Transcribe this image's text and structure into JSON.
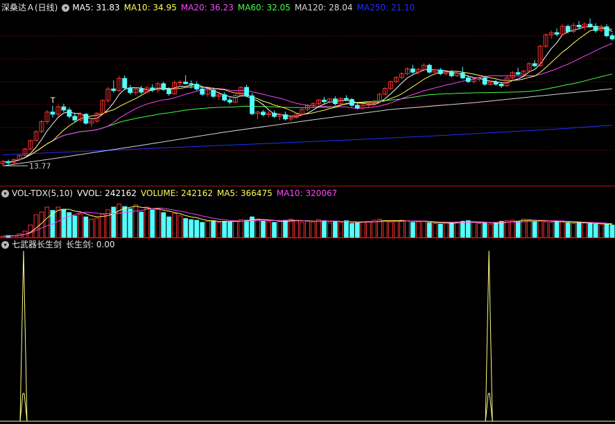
{
  "header1": {
    "title": "深桑达Ａ(日线)",
    "ma": [
      {
        "label": "MA5: 31.83",
        "color": "#ffffff"
      },
      {
        "label": "MA10: 34.95",
        "color": "#ffff55"
      },
      {
        "label": "MA20: 36.23",
        "color": "#ff44ff"
      },
      {
        "label": "MA60: 32.05",
        "color": "#44ff44"
      },
      {
        "label": "MA120: 28.04",
        "color": "#d8d8d8"
      },
      {
        "label": "MA250: 21.10",
        "color": "#2030ff"
      }
    ]
  },
  "header2": {
    "title": "VOL-TDX(5,10)",
    "vol": [
      {
        "label": "VVOL: 242162",
        "color": "#ffffff"
      },
      {
        "label": "VOLUME: 242162",
        "color": "#ffff55"
      },
      {
        "label": "MA5: 366475",
        "color": "#ffff55"
      },
      {
        "label": "MA10: 320067",
        "color": "#ff44ff"
      }
    ]
  },
  "header3": {
    "title": "七武器长生剑",
    "value": "长生剑: 0.00"
  },
  "annotations": {
    "low_price": "13.77",
    "marker": "T"
  },
  "colors": {
    "up": "#ff3232",
    "down": "#54ffff",
    "grid": "#b80f0f",
    "ma5": "#ffffff",
    "ma10": "#ffff55",
    "ma20": "#ff44ff",
    "ma60": "#44ff44",
    "ma120": "#d8d8d8",
    "ma250": "#2030ff",
    "signal": "#ffff88"
  },
  "chart_data": [
    {
      "type": "candlestick",
      "y_range": [
        12,
        42
      ],
      "bars_per_window": 111,
      "candles": [
        [
          13.8,
          14.5,
          13.4,
          14.2
        ],
        [
          14.2,
          14.6,
          13.6,
          14.0
        ],
        [
          14.0,
          14.8,
          13.7,
          14.6
        ],
        [
          14.6,
          15.5,
          14.3,
          15.4
        ],
        [
          15.4,
          16.8,
          15.2,
          16.6
        ],
        [
          16.6,
          18.4,
          16.4,
          18.2
        ],
        [
          18.2,
          20.2,
          18.0,
          19.9
        ],
        [
          19.9,
          22.1,
          19.6,
          21.8
        ],
        [
          21.8,
          24.0,
          21.3,
          23.6
        ],
        [
          23.6,
          24.8,
          22.6,
          23.2
        ],
        [
          23.2,
          25.0,
          22.8,
          24.6
        ],
        [
          24.6,
          25.2,
          23.6,
          24.0
        ],
        [
          24.0,
          24.5,
          22.4,
          22.8
        ],
        [
          22.8,
          23.5,
          21.6,
          22.1
        ],
        [
          22.1,
          23.6,
          21.8,
          23.2
        ],
        [
          23.2,
          23.4,
          21.2,
          21.5
        ],
        [
          21.5,
          22.1,
          20.8,
          21.9
        ],
        [
          21.9,
          23.6,
          21.6,
          23.4
        ],
        [
          23.4,
          26.1,
          23.1,
          25.8
        ],
        [
          25.8,
          28.4,
          25.4,
          28.0
        ],
        [
          28.0,
          29.6,
          27.3,
          27.7
        ],
        [
          27.7,
          30.5,
          27.4,
          30.0
        ],
        [
          30.0,
          30.6,
          27.8,
          28.2
        ],
        [
          28.2,
          28.8,
          26.9,
          27.3
        ],
        [
          27.3,
          28.4,
          26.8,
          28.0
        ],
        [
          28.0,
          28.6,
          27.0,
          27.4
        ],
        [
          27.4,
          28.6,
          27.1,
          28.2
        ],
        [
          28.2,
          28.9,
          27.4,
          27.8
        ],
        [
          27.8,
          29.3,
          27.3,
          29.0
        ],
        [
          29.0,
          29.4,
          27.6,
          27.9
        ],
        [
          27.9,
          28.3,
          26.7,
          27.1
        ],
        [
          27.1,
          29.6,
          26.9,
          29.2
        ],
        [
          29.2,
          29.7,
          28.4,
          29.3
        ],
        [
          29.3,
          30.6,
          28.9,
          29.0
        ],
        [
          29.0,
          29.6,
          28.1,
          28.9
        ],
        [
          28.9,
          29.4,
          27.7,
          28.0
        ],
        [
          28.0,
          28.4,
          26.7,
          27.0
        ],
        [
          27.0,
          28.1,
          26.5,
          27.8
        ],
        [
          27.8,
          28.3,
          26.3,
          26.6
        ],
        [
          26.6,
          27.2,
          25.9,
          26.9
        ],
        [
          26.9,
          27.4,
          25.6,
          25.9
        ],
        [
          25.9,
          26.4,
          25.1,
          25.5
        ],
        [
          25.5,
          27.0,
          25.3,
          26.8
        ],
        [
          26.8,
          28.5,
          26.5,
          28.3
        ],
        [
          28.3,
          28.8,
          26.4,
          26.7
        ],
        [
          26.7,
          27.2,
          23.0,
          23.3
        ],
        [
          23.3,
          23.9,
          22.3,
          23.6
        ],
        [
          23.6,
          24.0,
          22.8,
          23.1
        ],
        [
          23.1,
          23.8,
          22.6,
          23.4
        ],
        [
          23.4,
          23.9,
          22.5,
          22.8
        ],
        [
          22.8,
          23.4,
          22.1,
          23.1
        ],
        [
          23.1,
          23.7,
          22.0,
          22.3
        ],
        [
          22.3,
          23.0,
          21.9,
          22.6
        ],
        [
          22.6,
          23.4,
          22.4,
          23.2
        ],
        [
          23.2,
          24.3,
          23.0,
          24.1
        ],
        [
          24.1,
          25.1,
          23.8,
          24.8
        ],
        [
          24.8,
          25.5,
          24.4,
          25.2
        ],
        [
          25.2,
          26.1,
          24.9,
          25.9
        ],
        [
          25.9,
          26.5,
          25.2,
          25.6
        ],
        [
          25.6,
          26.3,
          25.3,
          26.1
        ],
        [
          26.1,
          26.6,
          24.9,
          25.2
        ],
        [
          25.2,
          26.4,
          25.0,
          26.2
        ],
        [
          26.2,
          26.8,
          25.8,
          26.0
        ],
        [
          26.0,
          26.3,
          24.6,
          24.9
        ],
        [
          24.9,
          25.3,
          24.1,
          24.4
        ],
        [
          24.4,
          25.1,
          24.0,
          24.9
        ],
        [
          24.9,
          25.5,
          24.5,
          25.2
        ],
        [
          25.2,
          25.9,
          24.8,
          25.6
        ],
        [
          25.6,
          27.2,
          25.3,
          27.0
        ],
        [
          27.0,
          28.3,
          26.8,
          28.1
        ],
        [
          28.1,
          29.6,
          27.9,
          29.4
        ],
        [
          29.4,
          30.4,
          29.1,
          30.2
        ],
        [
          30.2,
          31.2,
          29.8,
          30.9
        ],
        [
          30.9,
          32.1,
          30.6,
          31.8
        ],
        [
          31.8,
          32.6,
          30.9,
          31.2
        ],
        [
          31.2,
          32.0,
          30.8,
          31.7
        ],
        [
          31.7,
          32.9,
          31.4,
          32.5
        ],
        [
          32.5,
          32.8,
          30.9,
          31.2
        ],
        [
          31.2,
          31.9,
          30.7,
          31.6
        ],
        [
          31.6,
          32.0,
          30.6,
          30.9
        ],
        [
          30.9,
          31.5,
          30.5,
          31.2
        ],
        [
          31.2,
          31.6,
          30.2,
          30.5
        ],
        [
          30.5,
          31.3,
          30.3,
          31.0
        ],
        [
          31.0,
          32.2,
          29.9,
          30.1
        ],
        [
          30.1,
          30.6,
          29.1,
          29.4
        ],
        [
          29.4,
          30.1,
          29.0,
          29.8
        ],
        [
          29.8,
          30.4,
          29.4,
          30.1
        ],
        [
          30.1,
          30.5,
          28.6,
          28.9
        ],
        [
          28.9,
          29.6,
          28.7,
          29.3
        ],
        [
          29.3,
          29.7,
          28.6,
          28.9
        ],
        [
          28.9,
          29.3,
          28.2,
          28.6
        ],
        [
          28.6,
          30.4,
          28.4,
          30.1
        ],
        [
          30.1,
          31.4,
          29.8,
          31.1
        ],
        [
          31.1,
          32.0,
          30.6,
          30.8
        ],
        [
          30.8,
          31.6,
          30.5,
          31.4
        ],
        [
          31.4,
          33.1,
          31.1,
          32.8
        ],
        [
          32.8,
          33.5,
          32.1,
          32.4
        ],
        [
          32.4,
          36.4,
          32.2,
          36.1
        ],
        [
          36.1,
          38.6,
          35.8,
          38.3
        ],
        [
          38.3,
          39.1,
          37.5,
          38.7
        ],
        [
          38.7,
          39.5,
          38.0,
          38.4
        ],
        [
          38.4,
          40.3,
          38.1,
          39.9
        ],
        [
          39.9,
          40.2,
          38.5,
          38.9
        ],
        [
          38.9,
          40.6,
          38.6,
          40.1
        ],
        [
          40.1,
          40.9,
          39.4,
          39.8
        ],
        [
          39.8,
          40.7,
          39.1,
          40.3
        ],
        [
          40.3,
          41.4,
          39.6,
          39.9
        ],
        [
          39.9,
          40.5,
          38.7,
          39.1
        ],
        [
          39.1,
          40.2,
          38.8,
          39.8
        ],
        [
          39.8,
          40.3,
          37.8,
          38.1
        ],
        [
          38.1,
          38.6,
          37.2,
          37.5
        ]
      ],
      "ma120": [
        [
          0,
          13.4
        ],
        [
          10,
          14.9
        ],
        [
          25,
          17.3
        ],
        [
          40,
          19.8
        ],
        [
          55,
          22.0
        ],
        [
          70,
          24.1
        ],
        [
          85,
          25.4
        ],
        [
          100,
          27.0
        ],
        [
          110,
          28.04
        ]
      ],
      "ma250": [
        [
          0,
          15.5
        ],
        [
          20,
          16.4
        ],
        [
          40,
          17.3
        ],
        [
          60,
          18.2
        ],
        [
          80,
          19.2
        ],
        [
          100,
          20.4
        ],
        [
          110,
          21.1
        ]
      ]
    },
    {
      "type": "bar",
      "series_name": "VOLUME",
      "y_range": [
        0,
        700000
      ],
      "volumes": [
        25000,
        40000,
        35000,
        70000,
        120000,
        230000,
        420000,
        470000,
        560000,
        500000,
        560000,
        520000,
        460000,
        400000,
        430000,
        380000,
        340000,
        360000,
        430000,
        510000,
        560000,
        620000,
        570000,
        530000,
        600000,
        470000,
        560000,
        510000,
        520000,
        460000,
        380000,
        440000,
        400000,
        350000,
        330000,
        320000,
        280000,
        300000,
        310000,
        280000,
        300000,
        290000,
        310000,
        330000,
        320000,
        380000,
        340000,
        300000,
        290000,
        280000,
        300000,
        320000,
        340000,
        310000,
        280000,
        300000,
        290000,
        330000,
        310000,
        270000,
        300000,
        280000,
        310000,
        260000,
        270000,
        290000,
        300000,
        320000,
        340000,
        310000,
        290000,
        300000,
        320000,
        310000,
        280000,
        290000,
        300000,
        270000,
        260000,
        250000,
        270000,
        280000,
        290000,
        300000,
        310000,
        280000,
        260000,
        270000,
        250000,
        280000,
        300000,
        310000,
        320000,
        300000,
        340000,
        330000,
        300000,
        310000,
        290000,
        280000,
        300000,
        290000,
        270000,
        260000,
        280000,
        270000,
        260000,
        250000,
        240000,
        242162,
        230000
      ]
    },
    {
      "type": "line",
      "series_name": "长生剑",
      "y_range": [
        0,
        1
      ],
      "signal_indices": [
        8,
        176
      ],
      "bars": 222,
      "last_value": 0.0
    }
  ]
}
